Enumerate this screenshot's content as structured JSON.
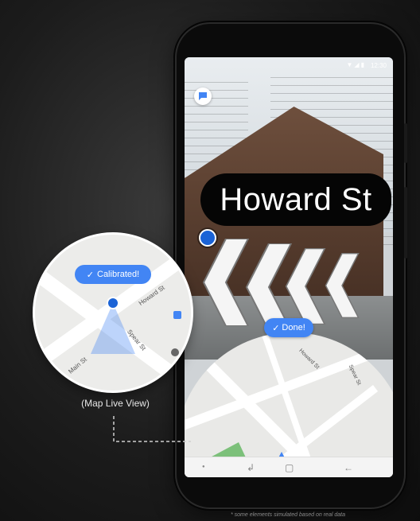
{
  "status_bar": {
    "time": "12:30",
    "icons": "▼◢▮"
  },
  "ar_view": {
    "street_name": "Howard St"
  },
  "map": {
    "done_label": "Done!",
    "streets": [
      "Howard St",
      "Spear St"
    ]
  },
  "magnifier": {
    "calibrated_label": "Calibrated!",
    "street_labels": [
      "Howard St",
      "Spear St",
      "Main St"
    ],
    "caption": "(Map Live View)"
  },
  "nav_icons": [
    "dot-icon",
    "route-icon",
    "recents-icon",
    "back-icon"
  ],
  "footnote": "* some elements simulated based on real data",
  "colors": {
    "accent": "#4285f4",
    "location_dot": "#1b63d6",
    "park": "#7cc07a"
  }
}
